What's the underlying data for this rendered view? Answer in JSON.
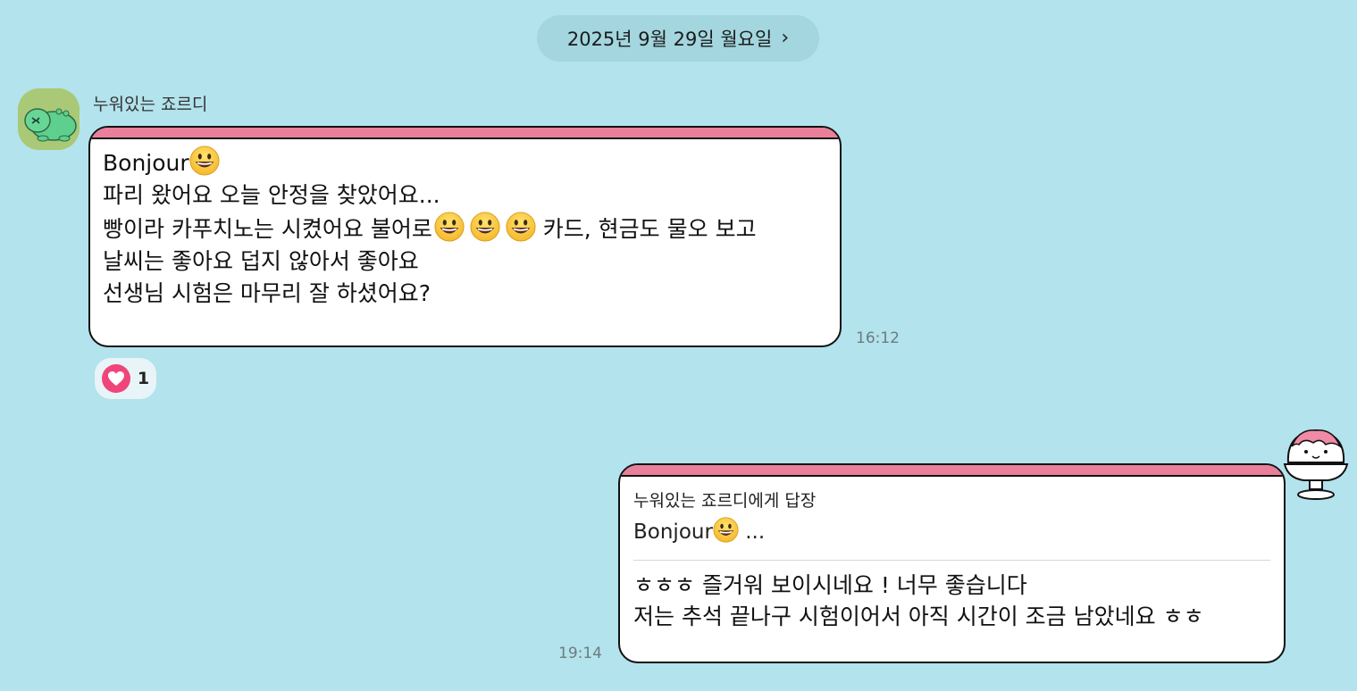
{
  "date_header": {
    "label": "2025년 9월 29일 월요일",
    "chevron": "›"
  },
  "incoming": {
    "sender_name": "누워있는 죠르디",
    "avatar_icon": "jordy-dinosaur-avatar",
    "lines": {
      "l1": "Bonjour",
      "l2": "파리 왔어요 오늘 안정을 찾았어요...",
      "l3a": "빵이라 카푸치노는 시켰어요 불어로",
      "l3b": " 카드, 현금도 물오 보고",
      "l4": "날씨는 좋아요 덥지 않아서 좋아요",
      "l5": "선생님 시험은 마무리 잘 하셨어요?"
    },
    "time": "16:12",
    "reaction": {
      "icon": "heart-icon",
      "count": "1",
      "color": "#f0457a"
    }
  },
  "outgoing": {
    "reply_to": "누워있는 죠르디에게 답장",
    "quote_text": "Bonjour",
    "quote_ellipsis": " ...",
    "lines": {
      "l1": "ㅎㅎㅎ 즐거워 보이시네요 ! 너무 좋습니다",
      "l2": "저는 추석 끝나구 시험이어서 아직 시간이 조금 남았네요 ㅎㅎ"
    },
    "time": "19:14",
    "avatar_icon": "shaved-ice-character-avatar"
  },
  "colors": {
    "background": "#b3e3ec",
    "bubble_accent": "#ea7f9b",
    "date_pill": "#a3d6df"
  }
}
